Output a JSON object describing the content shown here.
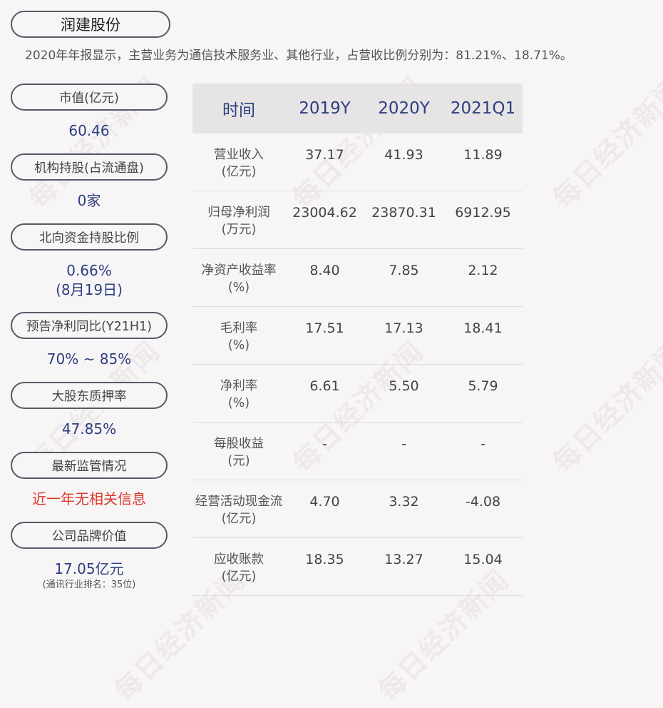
{
  "watermark_text": "每日经济新闻",
  "title": "润建股份",
  "summary": "2020年年报显示，主营业务为通信技术服务业、其他行业，占营收比例分别为：81.21%、18.71%。",
  "metrics": [
    {
      "label": "市值(亿元)",
      "value": "60.46"
    },
    {
      "label": "机构持股(占流通盘)",
      "value": "0家"
    },
    {
      "label": "北向资金持股比例",
      "value": "0.66%",
      "value2": "(8月19日)"
    },
    {
      "label": "预告净利同比(Y21H1)",
      "value": "70% ~ 85%"
    },
    {
      "label": "大股东质押率",
      "value": "47.85%"
    },
    {
      "label": "最新监管情况",
      "value": "近一年无相关信息",
      "value_color": "#d83a2a"
    },
    {
      "label": "公司品牌价值",
      "value": "17.05亿元",
      "sub": "(通讯行业排名：35位)"
    }
  ],
  "table": {
    "headers": [
      "时间",
      "2019Y",
      "2020Y",
      "2021Q1"
    ],
    "rows": [
      {
        "name": "营业收入",
        "unit": "(亿元)",
        "values": [
          "37.17",
          "41.93",
          "11.89"
        ]
      },
      {
        "name": "归母净利润",
        "unit": "(万元)",
        "values": [
          "23004.62",
          "23870.31",
          "6912.95"
        ]
      },
      {
        "name": "净资产收益率",
        "unit": "(%)",
        "values": [
          "8.40",
          "7.85",
          "2.12"
        ]
      },
      {
        "name": "毛利率",
        "unit": "(%)",
        "values": [
          "17.51",
          "17.13",
          "18.41"
        ]
      },
      {
        "name": "净利率",
        "unit": "(%)",
        "values": [
          "6.61",
          "5.50",
          "5.79"
        ]
      },
      {
        "name": "每股收益",
        "unit": "(元)",
        "values": [
          "-",
          "-",
          "-"
        ]
      },
      {
        "name": "经营活动现金流",
        "unit": "(亿元)",
        "values": [
          "4.70",
          "3.32",
          "-4.08"
        ]
      },
      {
        "name": "应收账款",
        "unit": "(亿元)",
        "values": [
          "18.35",
          "13.27",
          "15.04"
        ]
      }
    ]
  },
  "colors": {
    "background": "#f8f5f6",
    "accent_blue": "#2c3e80",
    "alert_red": "#d83a2a",
    "header_bg": "#e6e4e5"
  }
}
